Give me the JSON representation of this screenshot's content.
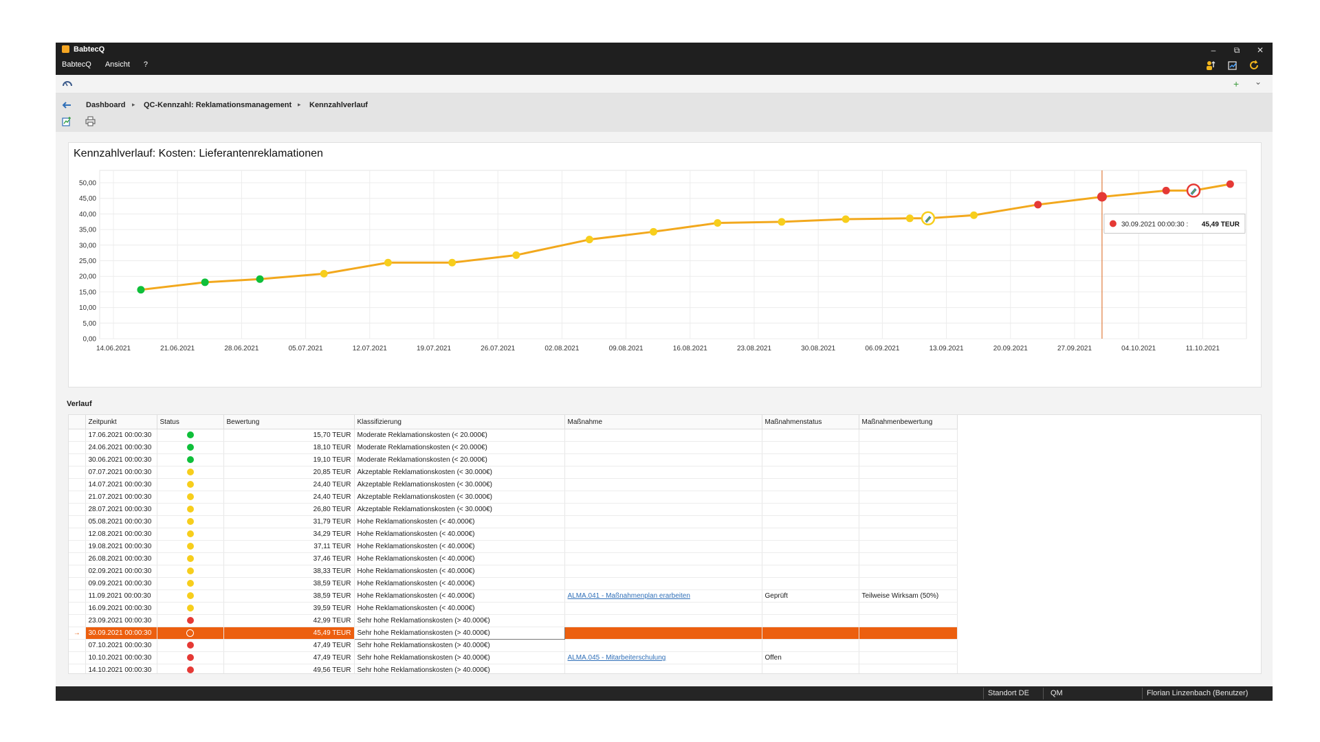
{
  "window": {
    "title": "BabtecQ",
    "menu": [
      "BabtecQ",
      "Ansicht",
      "?"
    ],
    "controls": {
      "minimize": "–",
      "restore": "⧉",
      "close": "✕"
    }
  },
  "tabstrip": {
    "add": "+",
    "dropdown": "⌄"
  },
  "breadcrumb": {
    "items": [
      "Dashboard",
      "QC-Kennzahl: Reklamationsmanagement",
      "Kennzahlverlauf"
    ],
    "separator": "▸"
  },
  "chart_title": "Kennzahlverlauf: Kosten: Lieferantenreklamationen",
  "chart_data": {
    "type": "line",
    "title": "Kennzahlverlauf: Kosten: Lieferantenreklamationen",
    "xlabel": "",
    "ylabel": "",
    "ylim": [
      0,
      50
    ],
    "y_ticks": [
      "50,00",
      "45,00",
      "40,00",
      "35,00",
      "30,00",
      "25,00",
      "20,00",
      "15,00",
      "10,00",
      "5,00",
      "0,00"
    ],
    "x_ticks": [
      "14.06.2021",
      "21.06.2021",
      "28.06.2021",
      "05.07.2021",
      "12.07.2021",
      "19.07.2021",
      "26.07.2021",
      "02.08.2021",
      "09.08.2021",
      "16.08.2021",
      "23.08.2021",
      "30.08.2021",
      "06.09.2021",
      "13.09.2021",
      "20.09.2021",
      "27.09.2021",
      "04.10.2021",
      "11.10.2021"
    ],
    "grid": true,
    "line_color": "#f2a81d",
    "status_colors": {
      "green": "#0fbf3a",
      "yellow": "#f7ce1c",
      "red": "#e53935"
    },
    "points": [
      {
        "date": "2021-06-17",
        "value": 15.7,
        "status": "green"
      },
      {
        "date": "2021-06-24",
        "value": 18.1,
        "status": "green"
      },
      {
        "date": "2021-06-30",
        "value": 19.1,
        "status": "green"
      },
      {
        "date": "2021-07-07",
        "value": 20.85,
        "status": "yellow"
      },
      {
        "date": "2021-07-14",
        "value": 24.4,
        "status": "yellow"
      },
      {
        "date": "2021-07-21",
        "value": 24.4,
        "status": "yellow"
      },
      {
        "date": "2021-07-28",
        "value": 26.8,
        "status": "yellow"
      },
      {
        "date": "2021-08-05",
        "value": 31.79,
        "status": "yellow"
      },
      {
        "date": "2021-08-12",
        "value": 34.29,
        "status": "yellow"
      },
      {
        "date": "2021-08-19",
        "value": 37.11,
        "status": "yellow"
      },
      {
        "date": "2021-08-26",
        "value": 37.46,
        "status": "yellow"
      },
      {
        "date": "2021-09-02",
        "value": 38.33,
        "status": "yellow"
      },
      {
        "date": "2021-09-09",
        "value": 38.59,
        "status": "yellow"
      },
      {
        "date": "2021-09-11",
        "value": 38.59,
        "status": "yellow",
        "marker": "measure"
      },
      {
        "date": "2021-09-16",
        "value": 39.59,
        "status": "yellow"
      },
      {
        "date": "2021-09-23",
        "value": 42.99,
        "status": "red"
      },
      {
        "date": "2021-09-30",
        "value": 45.49,
        "status": "red",
        "selected": true
      },
      {
        "date": "2021-10-07",
        "value": 47.49,
        "status": "red"
      },
      {
        "date": "2021-10-10",
        "value": 47.49,
        "status": "red",
        "marker": "measure"
      },
      {
        "date": "2021-10-14",
        "value": 49.56,
        "status": "red"
      }
    ],
    "tooltip": {
      "label": "30.09.2021 00:00:30 :",
      "value": "45,49 TEUR"
    }
  },
  "verlauf_label": "Verlauf",
  "table": {
    "columns": [
      "Zeitpunkt",
      "Status",
      "Bewertung",
      "Klassifizierung",
      "Maßnahme",
      "Maßnahmenstatus",
      "Maßnahmenbewertung"
    ],
    "rows": [
      {
        "zeit": "17.06.2021 00:00:30",
        "status": "green",
        "bew": "15,70 TEUR",
        "klass": "Moderate Reklamationskosten (< 20.000€)",
        "mass": "",
        "mstatus": "",
        "mbew": ""
      },
      {
        "zeit": "24.06.2021 00:00:30",
        "status": "green",
        "bew": "18,10 TEUR",
        "klass": "Moderate Reklamationskosten (< 20.000€)",
        "mass": "",
        "mstatus": "",
        "mbew": ""
      },
      {
        "zeit": "30.06.2021 00:00:30",
        "status": "green",
        "bew": "19,10 TEUR",
        "klass": "Moderate Reklamationskosten (< 20.000€)",
        "mass": "",
        "mstatus": "",
        "mbew": ""
      },
      {
        "zeit": "07.07.2021 00:00:30",
        "status": "yellow",
        "bew": "20,85 TEUR",
        "klass": "Akzeptable Reklamationskosten (< 30.000€)",
        "mass": "",
        "mstatus": "",
        "mbew": ""
      },
      {
        "zeit": "14.07.2021 00:00:30",
        "status": "yellow",
        "bew": "24,40 TEUR",
        "klass": "Akzeptable Reklamationskosten (< 30.000€)",
        "mass": "",
        "mstatus": "",
        "mbew": ""
      },
      {
        "zeit": "21.07.2021 00:00:30",
        "status": "yellow",
        "bew": "24,40 TEUR",
        "klass": "Akzeptable Reklamationskosten (< 30.000€)",
        "mass": "",
        "mstatus": "",
        "mbew": ""
      },
      {
        "zeit": "28.07.2021 00:00:30",
        "status": "yellow",
        "bew": "26,80 TEUR",
        "klass": "Akzeptable Reklamationskosten (< 30.000€)",
        "mass": "",
        "mstatus": "",
        "mbew": ""
      },
      {
        "zeit": "05.08.2021 00:00:30",
        "status": "yellow",
        "bew": "31,79 TEUR",
        "klass": "Hohe Reklamationskosten (< 40.000€)",
        "mass": "",
        "mstatus": "",
        "mbew": ""
      },
      {
        "zeit": "12.08.2021 00:00:30",
        "status": "yellow",
        "bew": "34,29 TEUR",
        "klass": "Hohe Reklamationskosten (< 40.000€)",
        "mass": "",
        "mstatus": "",
        "mbew": ""
      },
      {
        "zeit": "19.08.2021 00:00:30",
        "status": "yellow",
        "bew": "37,11 TEUR",
        "klass": "Hohe Reklamationskosten (< 40.000€)",
        "mass": "",
        "mstatus": "",
        "mbew": ""
      },
      {
        "zeit": "26.08.2021 00:00:30",
        "status": "yellow",
        "bew": "37,46 TEUR",
        "klass": "Hohe Reklamationskosten (< 40.000€)",
        "mass": "",
        "mstatus": "",
        "mbew": ""
      },
      {
        "zeit": "02.09.2021 00:00:30",
        "status": "yellow",
        "bew": "38,33 TEUR",
        "klass": "Hohe Reklamationskosten (< 40.000€)",
        "mass": "",
        "mstatus": "",
        "mbew": ""
      },
      {
        "zeit": "09.09.2021 00:00:30",
        "status": "yellow",
        "bew": "38,59 TEUR",
        "klass": "Hohe Reklamationskosten (< 40.000€)",
        "mass": "",
        "mstatus": "",
        "mbew": ""
      },
      {
        "zeit": "11.09.2021 00:00:30",
        "status": "yellow",
        "bew": "38,59 TEUR",
        "klass": "Hohe Reklamationskosten (< 40.000€)",
        "mass": "ALMA.041 - Maßnahmenplan erarbeiten",
        "mstatus": "Geprüft",
        "mbew": "Teilweise Wirksam (50%)"
      },
      {
        "zeit": "16.09.2021 00:00:30",
        "status": "yellow",
        "bew": "39,59 TEUR",
        "klass": "Hohe Reklamationskosten (< 40.000€)",
        "mass": "",
        "mstatus": "",
        "mbew": ""
      },
      {
        "zeit": "23.09.2021 00:00:30",
        "status": "red",
        "bew": "42,99 TEUR",
        "klass": "Sehr hohe Reklamationskosten (> 40.000€)",
        "mass": "",
        "mstatus": "",
        "mbew": ""
      },
      {
        "zeit": "30.09.2021 00:00:30",
        "status": "red",
        "bew": "45,49 TEUR",
        "klass": "Sehr hohe Reklamationskosten (> 40.000€)",
        "mass": "",
        "mstatus": "",
        "mbew": "",
        "selected": true
      },
      {
        "zeit": "07.10.2021 00:00:30",
        "status": "red",
        "bew": "47,49 TEUR",
        "klass": "Sehr hohe Reklamationskosten (> 40.000€)",
        "mass": "",
        "mstatus": "",
        "mbew": ""
      },
      {
        "zeit": "10.10.2021 00:00:30",
        "status": "red",
        "bew": "47,49 TEUR",
        "klass": "Sehr hohe Reklamationskosten (> 40.000€)",
        "mass": "ALMA.045 - Mitarbeiterschulung",
        "mstatus": "Offen",
        "mbew": ""
      },
      {
        "zeit": "14.10.2021 00:00:30",
        "status": "red",
        "bew": "49,56 TEUR",
        "klass": "Sehr hohe Reklamationskosten (> 40.000€)",
        "mass": "",
        "mstatus": "",
        "mbew": ""
      }
    ]
  },
  "statusbar": {
    "standort": "Standort DE",
    "bereich": "QM",
    "user": "Florian Linzenbach (Benutzer)"
  },
  "colors": {
    "accent_orange": "#ec5f0f",
    "titlebar": "#1f1f1f",
    "link": "#2f6fb8"
  }
}
